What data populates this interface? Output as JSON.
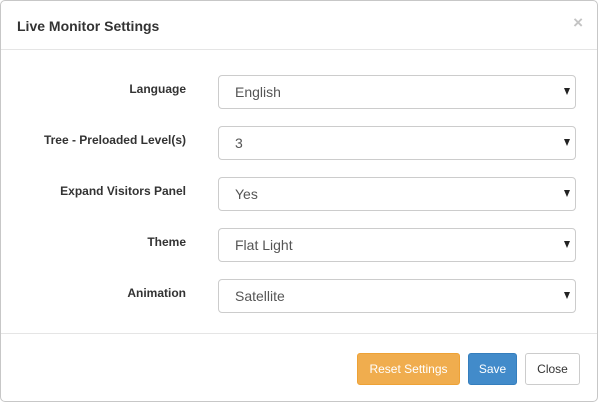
{
  "dialog": {
    "title": "Live Monitor Settings",
    "close_glyph": "×"
  },
  "settings": [
    {
      "label": "Language",
      "value": "English"
    },
    {
      "label": "Tree - Preloaded Level(s)",
      "value": "3"
    },
    {
      "label": "Expand Visitors Panel",
      "value": "Yes"
    },
    {
      "label": "Theme",
      "value": "Flat Light"
    },
    {
      "label": "Animation",
      "value": "Satellite"
    }
  ],
  "footer": {
    "reset_label": "Reset Settings",
    "save_label": "Save",
    "close_label": "Close"
  },
  "colors": {
    "reset": "#f0ad4e",
    "save": "#428bca",
    "close": "#ffffff"
  }
}
